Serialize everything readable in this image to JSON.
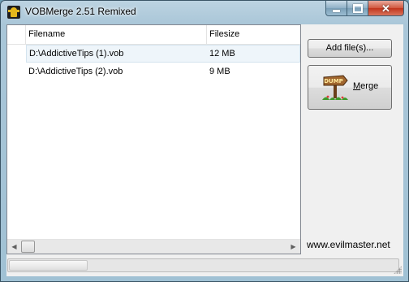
{
  "window": {
    "title": "VOBMerge 2.51 Remixed"
  },
  "list": {
    "columns": [
      "",
      "Filename",
      "Filesize"
    ],
    "rows": [
      {
        "filename": "D:\\AddictiveTips (1).vob",
        "filesize": "12 MB"
      },
      {
        "filename": "D:\\AddictiveTips (2).vob",
        "filesize": "9 MB"
      }
    ]
  },
  "buttons": {
    "add_files": "Add file(s)...",
    "merge_underline": "M",
    "merge_rest": "erge",
    "merge_icon_text": "DUMP"
  },
  "credit": "www.evilmaster.net",
  "icons": {
    "app": "vob-figure-icon",
    "merge": "dump-sign-icon",
    "minimize": "minimize-icon",
    "maximize": "maximize-icon",
    "close": "close-icon"
  }
}
